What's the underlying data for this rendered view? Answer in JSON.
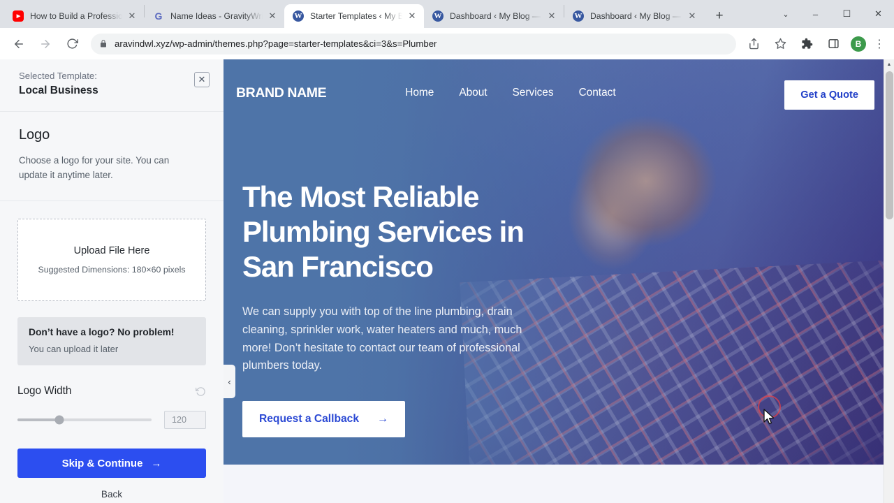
{
  "browser": {
    "tabs": [
      {
        "title": "How to Build a Professional",
        "favicon": "youtube-icon",
        "active": false
      },
      {
        "title": "Name Ideas - GravityWrite",
        "favicon": "gravitywrite-icon",
        "active": false
      },
      {
        "title": "Starter Templates ‹ My Blog",
        "favicon": "wordpress-icon",
        "active": true
      },
      {
        "title": "Dashboard ‹ My Blog — Wo",
        "favicon": "wordpress-icon",
        "active": false
      },
      {
        "title": "Dashboard ‹ My Blog — Wo",
        "favicon": "wordpress-icon",
        "active": false
      }
    ],
    "new_tab_label": "+",
    "tab_close_label": "✕",
    "window_controls": {
      "tab_search": "⌄",
      "minimize": "–",
      "maximize": "☐",
      "close": "✕"
    },
    "toolbar": {
      "back_label": "←",
      "forward_label": "→",
      "reload_label": "⟳",
      "url": "aravindwl.xyz/wp-admin/themes.php?page=starter-templates&ci=3&s=Plumber",
      "url_placeholder": "Search Google or type a URL",
      "lock_icon": "lock-icon",
      "share_icon": "share-icon",
      "bookmark_icon": "star-icon",
      "extensions_icon": "puzzle-icon",
      "sidepanel_icon": "side-panel-icon",
      "profile_initial": "B",
      "menu_label": "⋮"
    }
  },
  "sidebar": {
    "selected_template_label": "Selected Template:",
    "selected_template_name": "Local Business",
    "close_label": "✕",
    "logo_section": {
      "title": "Logo",
      "description": "Choose a logo for your site. You can update it anytime later."
    },
    "upload": {
      "title": "Upload File Here",
      "dimensions": "Suggested Dimensions: 180×60 pixels"
    },
    "no_logo_notice": {
      "title": "Don’t have a logo? No problem!",
      "subtitle": "You can upload it later"
    },
    "logo_width": {
      "label": "Logo Width",
      "value": "120",
      "placeholder": "120",
      "reset_icon": "reset-icon",
      "slider_percent": 31
    },
    "skip_button": "Skip & Continue",
    "skip_arrow": "→",
    "back_button": "Back",
    "collapse_handle": "‹"
  },
  "preview": {
    "brand": "BRAND NAME",
    "menu": [
      "Home",
      "About",
      "Services",
      "Contact"
    ],
    "quote_button": "Get a Quote",
    "heading": "The Most Reliable Plumbing Services in San Francisco",
    "paragraph": "We can supply you with top of the line plumbing, drain cleaning, sprinkler work, water heaters and much, much more! Don’t hesitate to contact our team of professional plumbers today.",
    "cta": "Request a Callback",
    "cta_arrow": "→"
  },
  "colors": {
    "accent_blue": "#2c4ef0",
    "hero_overlay": "#4e74a8",
    "cta_text": "#2b49d4",
    "profile_green": "#3c9a4b",
    "annotation_red": "#e0404a"
  }
}
